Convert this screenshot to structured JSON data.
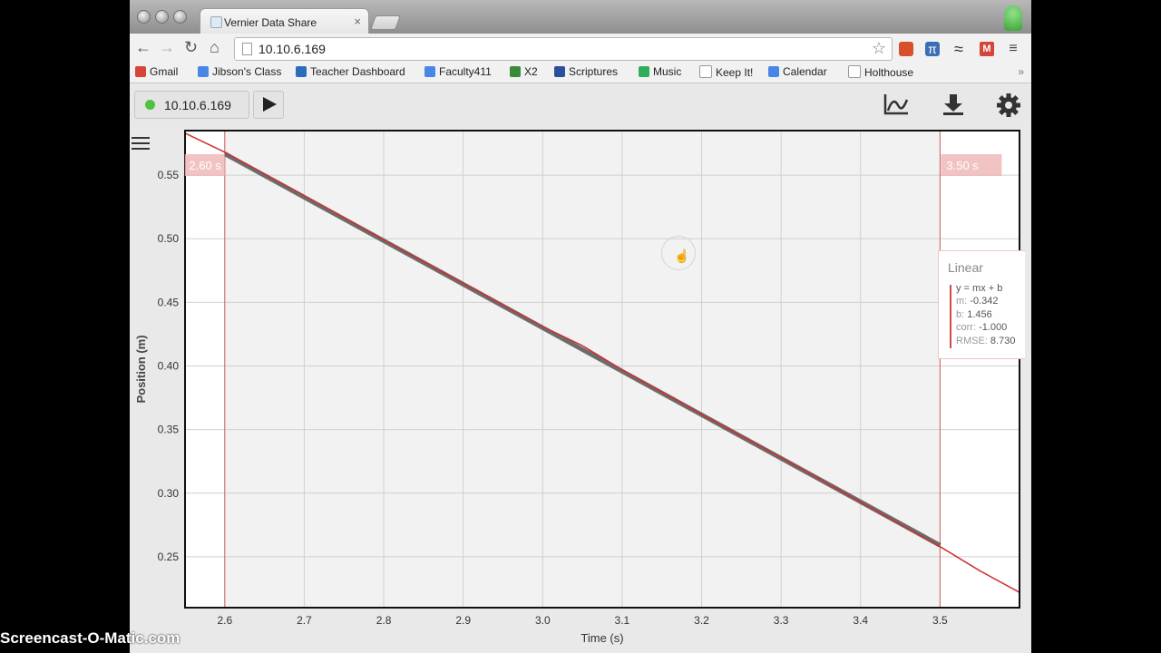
{
  "browser": {
    "tab_title": "Vernier Data Share",
    "tab_close": "×",
    "url": "10.10.6.169",
    "nav": {
      "back": "←",
      "forward": "→",
      "reload": "↻",
      "home": "⌂",
      "star": "☆"
    }
  },
  "bookmarks": [
    {
      "label": "Gmail",
      "icon": "gmail-icon",
      "color": "#d44638"
    },
    {
      "label": "Jibson's Class",
      "icon": "calendar-icon",
      "color": "#4a86e8"
    },
    {
      "label": "Teacher Dashboard",
      "icon": "dashboard-icon",
      "color": "#2a6ebb"
    },
    {
      "label": "Faculty411",
      "icon": "calendar-icon",
      "color": "#4a86e8"
    },
    {
      "label": "X2",
      "icon": "leaf-icon",
      "color": "#3b8a3b"
    },
    {
      "label": "Scriptures",
      "icon": "scriptures-icon",
      "color": "#2b4f9a"
    },
    {
      "label": "Music",
      "icon": "play-store-icon",
      "color": "#2fae5a"
    },
    {
      "label": "Keep It!",
      "icon": "page-icon",
      "color": "#ffffff"
    },
    {
      "label": "Calendar",
      "icon": "calendar-icon",
      "color": "#4a86e8"
    },
    {
      "label": "Holthouse",
      "icon": "page-icon",
      "color": "#ffffff"
    }
  ],
  "bookmarks_overflow": "»",
  "app": {
    "connection_ip": "10.10.6.169",
    "status_color": "#4fc241"
  },
  "fit": {
    "title": "Linear",
    "equation": "y = mx + b",
    "m_label": "m:",
    "m_value": "-0.342",
    "b_label": "b:",
    "b_value": "1.456",
    "corr_label": "corr:",
    "corr_value": "-1.000",
    "rmse_label": "RMSE:",
    "rmse_value": "8.730"
  },
  "watermark": "Screencast-O-Matic.com",
  "chart_data": {
    "type": "line",
    "xlabel": "Time (s)",
    "ylabel": "Position (m)",
    "xlim": [
      2.55,
      3.6
    ],
    "ylim": [
      0.21,
      0.585
    ],
    "x_ticks": [
      2.6,
      2.7,
      2.8,
      2.9,
      3.0,
      3.1,
      3.2,
      3.3,
      3.4,
      3.5
    ],
    "x_tick_labels": [
      "2.6",
      "2.7",
      "2.8",
      "2.9",
      "3.0",
      "3.1",
      "3.2",
      "3.3",
      "3.4",
      "3.5"
    ],
    "y_ticks": [
      0.25,
      0.3,
      0.35,
      0.4,
      0.45,
      0.5,
      0.55
    ],
    "y_tick_labels": [
      "0.25",
      "0.30",
      "0.35",
      "0.40",
      "0.45",
      "0.50",
      "0.55"
    ],
    "grid": true,
    "selection": {
      "start": 2.6,
      "end": 3.5,
      "start_label": "2.60 s",
      "end_label": "3.50 s"
    },
    "series": [
      {
        "color": "#d03030",
        "x": [
          2.55,
          2.6,
          2.7,
          2.8,
          2.9,
          3.0,
          3.05,
          3.1,
          3.2,
          3.3,
          3.4,
          3.5,
          3.55,
          3.6
        ],
        "y": [
          0.583,
          0.568,
          0.534,
          0.499,
          0.465,
          0.431,
          0.416,
          0.397,
          0.362,
          0.328,
          0.293,
          0.258,
          0.239,
          0.222
        ]
      }
    ],
    "fit_line": {
      "color": "#555555",
      "m": -0.342,
      "b": 1.456,
      "x_start": 2.6,
      "x_end": 3.5
    }
  }
}
